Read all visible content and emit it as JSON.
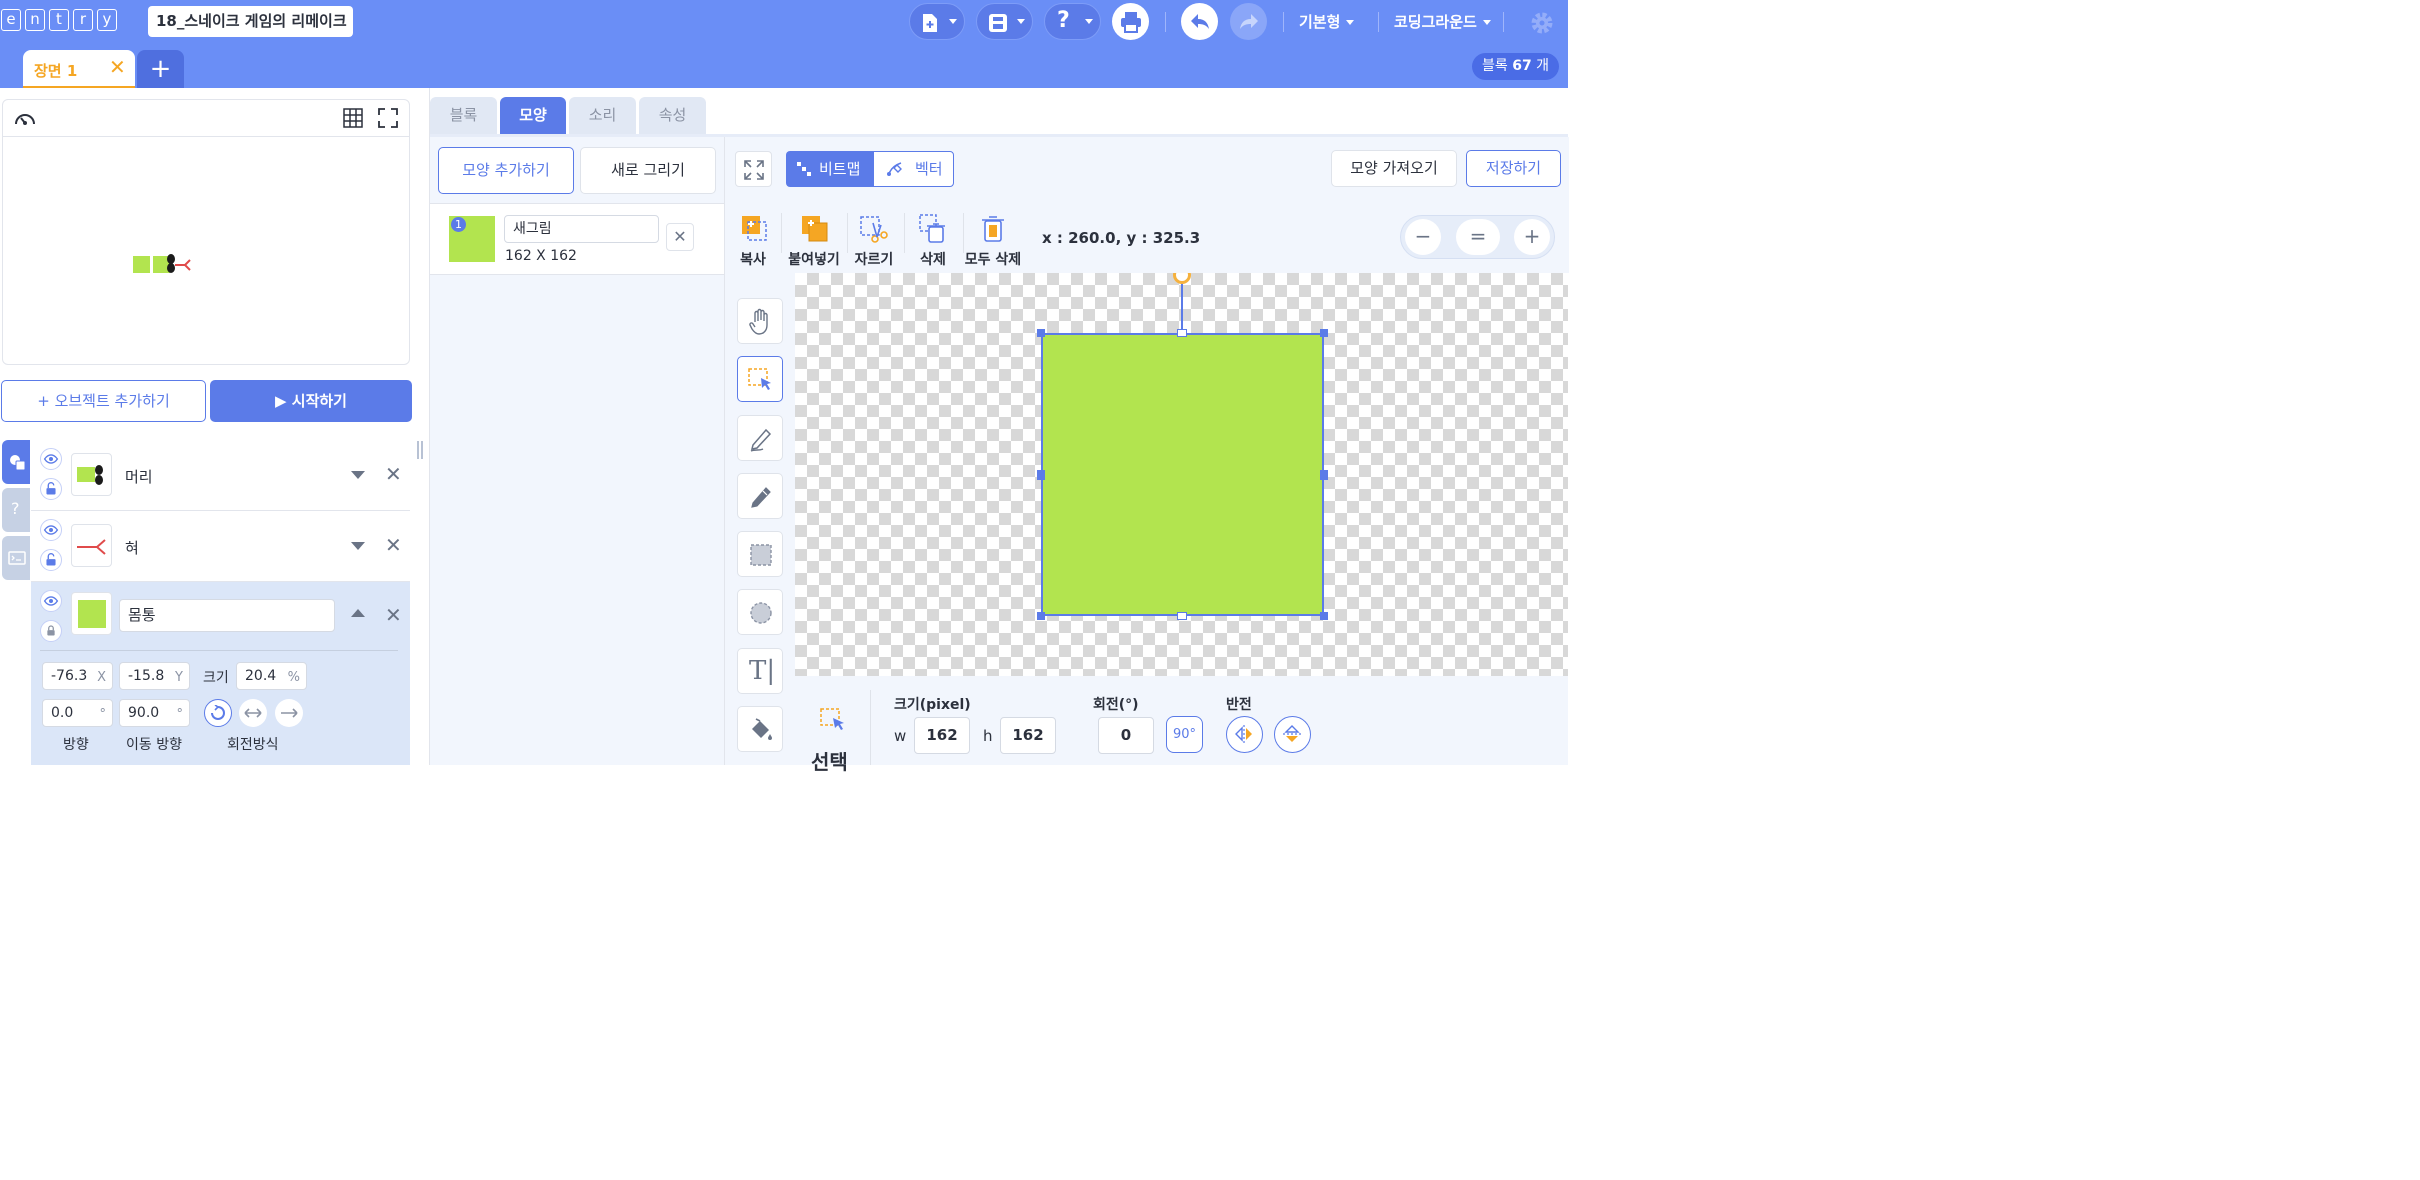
{
  "header": {
    "logo_letters": [
      "e",
      "n",
      "t",
      "r",
      "y"
    ],
    "project_title": "18_스네이크 게임의 리메이크",
    "mode_menu": "기본형",
    "theme_menu": "코딩그라운드",
    "block_count_prefix": "블록",
    "block_count": "67",
    "block_count_suffix": "개"
  },
  "scene": {
    "tab_label": "장면 1",
    "close_glyph": "✕",
    "add_glyph": "+"
  },
  "stage": {
    "add_object_label": "+ 오브젝트 추가하기",
    "start_label": "▶ 시작하기"
  },
  "objects": [
    {
      "name": "머리"
    },
    {
      "name": "혀"
    },
    {
      "name": "몸통"
    }
  ],
  "selected_object": {
    "x": "-76.3",
    "x_unit": "X",
    "y": "-15.8",
    "y_unit": "Y",
    "size_label": "크기",
    "size": "20.4",
    "size_unit": "%",
    "direction": "0.0",
    "move_direction": "90.0",
    "degree_unit": "°",
    "direction_label": "방향",
    "move_direction_label": "이동 방향",
    "rotation_mode_label": "회전방식"
  },
  "tabs": [
    "블록",
    "모양",
    "소리",
    "속성"
  ],
  "shapes_panel": {
    "add_shape_label": "모양 추가하기",
    "new_drawing_label": "새로 그리기",
    "items": [
      {
        "index": "1",
        "name": "새그림",
        "size": "162 X 162"
      }
    ]
  },
  "paint": {
    "bitmap_label": "비트맵",
    "vector_label": "벡터",
    "import_label": "모양 가져오기",
    "save_label": "저장하기",
    "tools": {
      "copy": "복사",
      "paste": "붙여넣기",
      "cut": "자르기",
      "delete": "삭제",
      "delete_all": "모두 삭제"
    },
    "coords": "x : 260.0, y : 325.3",
    "zoom": {
      "minus": "−",
      "equal": "=",
      "plus": "+"
    },
    "select_label": "선택",
    "size_label": "크기(pixel)",
    "w_label": "w",
    "w": "162",
    "h_label": "h",
    "h": "162",
    "rotate_label": "회전(°)",
    "rotate": "0",
    "rotate_90": "90°",
    "flip_label": "반전",
    "fill_color": "#b2e44f",
    "accent": "#5b7be8"
  }
}
